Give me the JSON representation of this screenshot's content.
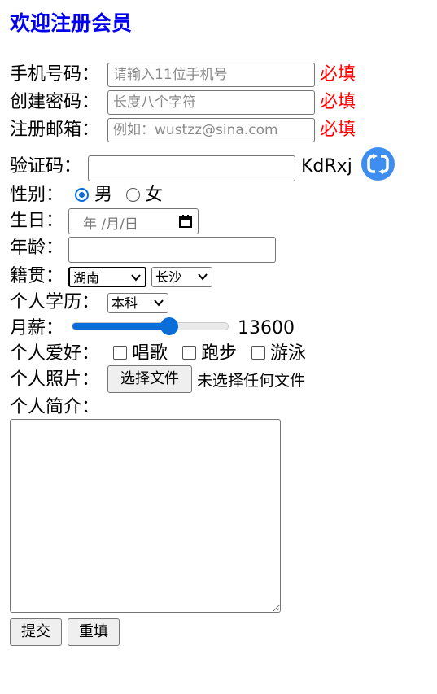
{
  "title": "欢迎注册会员",
  "form": {
    "phone": {
      "label": "手机号码：",
      "placeholder": "请输入11位手机号",
      "required": "必填"
    },
    "password": {
      "label": "创建密码：",
      "placeholder": "长度八个字符",
      "required": "必填"
    },
    "email": {
      "label": "注册邮箱：",
      "placeholder": "例如：wustzz@sina.com",
      "required": "必填"
    },
    "captcha": {
      "label": "验证码：",
      "code": "KdRxj",
      "refresh_icon": "refresh-icon"
    },
    "gender": {
      "label": "性别：",
      "options": [
        "男",
        "女"
      ],
      "selected": "男"
    },
    "birthday": {
      "label": "生日：",
      "placeholder_text": "年 /月/日",
      "calendar_icon": "calendar-icon"
    },
    "age": {
      "label": "年龄：",
      "value": ""
    },
    "native_place": {
      "label": "籍贯：",
      "province": "湖南",
      "city": "长沙"
    },
    "education": {
      "label": "个人学历：",
      "selected": "本科"
    },
    "salary": {
      "label": "月薪：",
      "value": "13600",
      "slider_fraction": 0.64
    },
    "hobbies": {
      "label": "个人爱好：",
      "options": [
        "唱歌",
        "跑步",
        "游泳"
      ]
    },
    "photo": {
      "label": "个人照片：",
      "button": "选择文件",
      "status": "未选择任何文件"
    },
    "intro": {
      "label": "个人简介："
    },
    "submit_label": "提交",
    "reset_label": "重填"
  },
  "colors": {
    "title": "#0000ee",
    "required": "#ff0000",
    "accent": "#0a6dd8",
    "refresh_icon": "#3d8ef0"
  }
}
